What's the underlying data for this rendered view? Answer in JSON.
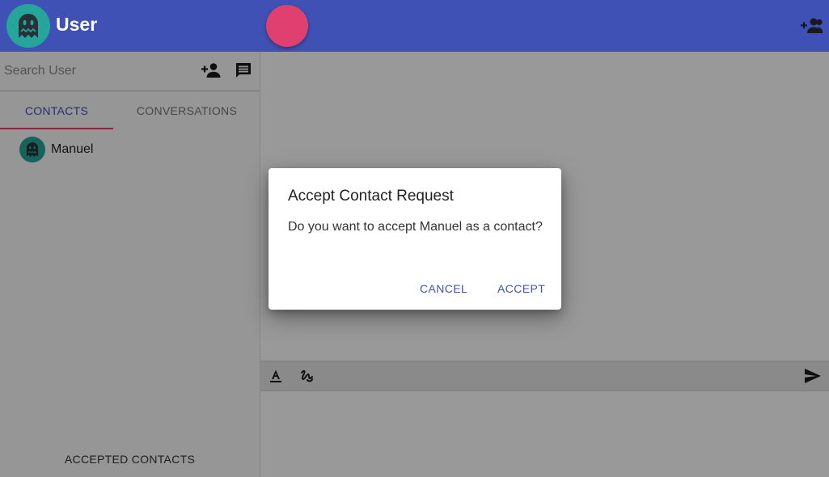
{
  "header": {
    "user_name": "User",
    "avatar_icon": "ghost-icon",
    "group_add_icon": "group-add-icon",
    "fab_color": "#e0406f",
    "bar_color": "#3f51b5"
  },
  "sidebar": {
    "search": {
      "placeholder": "Search User",
      "value": ""
    },
    "add_contact_icon": "person-add-icon",
    "new_chat_icon": "chat-icon",
    "tabs": [
      {
        "label": "CONTACTS",
        "active": true
      },
      {
        "label": "CONVERSATIONS",
        "active": false
      }
    ],
    "contacts": [
      {
        "name": "Manuel",
        "avatar_icon": "ghost-icon"
      }
    ],
    "bottom_tab": "ACCEPTED CONTACTS"
  },
  "chat": {
    "toolbar_icons": [
      "text-format-icon",
      "gesture-icon",
      "send-icon"
    ]
  },
  "dialog": {
    "title": "Accept Contact Request",
    "message": "Do you want to accept Manuel as a contact?",
    "cancel_label": "CANCEL",
    "accept_label": "ACCEPT"
  }
}
